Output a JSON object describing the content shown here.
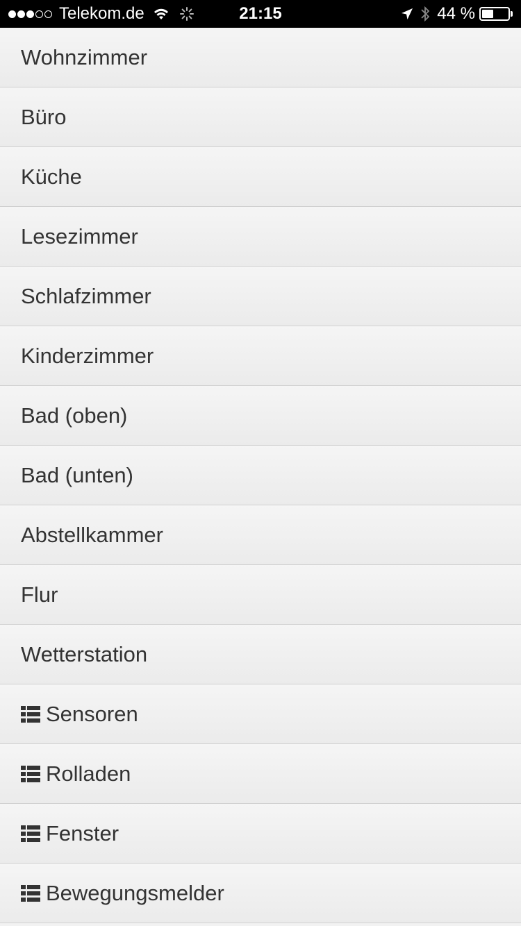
{
  "status_bar": {
    "signal_filled": 3,
    "signal_total": 5,
    "carrier": "Telekom.de",
    "time": "21:15",
    "battery_text": "44 %",
    "battery_level": 0.44
  },
  "menu": {
    "items": [
      {
        "label": "Wohnzimmer",
        "icon": ""
      },
      {
        "label": "Büro",
        "icon": ""
      },
      {
        "label": "Küche",
        "icon": ""
      },
      {
        "label": "Lesezimmer",
        "icon": ""
      },
      {
        "label": "Schlafzimmer",
        "icon": ""
      },
      {
        "label": "Kinderzimmer",
        "icon": ""
      },
      {
        "label": "Bad (oben)",
        "icon": ""
      },
      {
        "label": "Bad (unten)",
        "icon": ""
      },
      {
        "label": "Abstellkammer",
        "icon": ""
      },
      {
        "label": "Flur",
        "icon": ""
      },
      {
        "label": "Wetterstation",
        "icon": ""
      },
      {
        "label": "Sensoren",
        "icon": "list-icon"
      },
      {
        "label": "Rolladen",
        "icon": "list-icon"
      },
      {
        "label": "Fenster",
        "icon": "list-icon"
      },
      {
        "label": "Bewegungsmelder",
        "icon": "list-icon"
      }
    ]
  },
  "colors": {
    "status_bar_bg": "#000000",
    "item_text": "#333333",
    "item_bg": "#f2f2f2",
    "divider": "#d0d0d0"
  }
}
